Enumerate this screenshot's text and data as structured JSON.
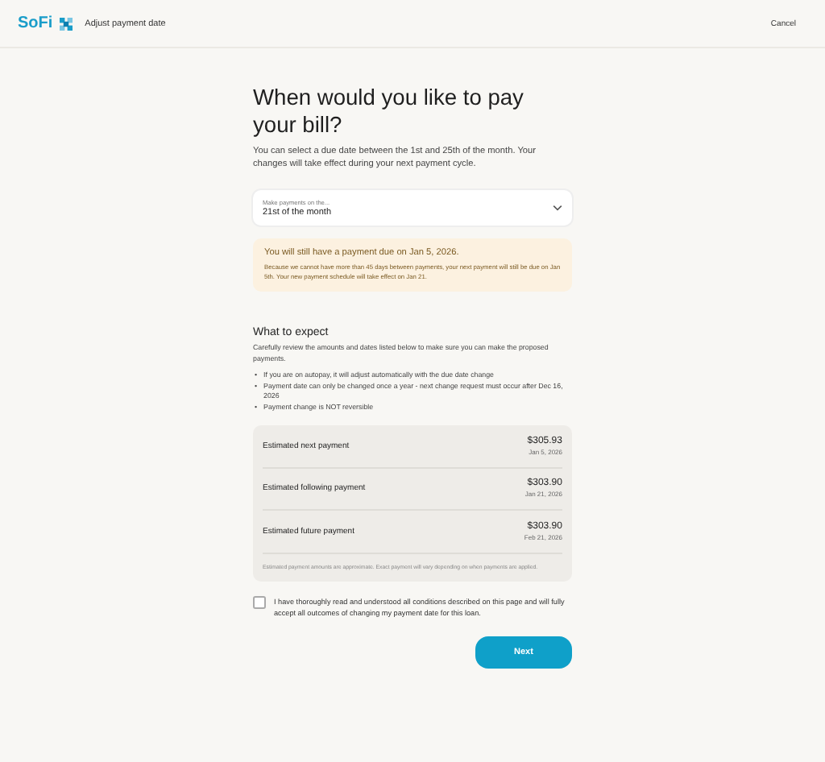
{
  "header": {
    "logo": "SoFi",
    "title": "Adjust payment date",
    "cancel": "Cancel"
  },
  "heading": "When would you like to pay your bill?",
  "intro": "You can select a due date between the 1st and 25th of the month. Your changes will take effect during your next payment cycle.",
  "dropdown": {
    "label": "Make payments on the...",
    "value": "21st of the month"
  },
  "notice": {
    "title": "You will still have a payment due on Jan 5, 2026.",
    "body": "Because we cannot have more than 45 days between payments, your next payment will still be due on Jan 5th. Your new payment schedule will take effect on Jan 21."
  },
  "expect": {
    "title": "What to expect",
    "description": "Carefully review the amounts and dates listed below to make sure you can make the proposed payments.",
    "bullets": [
      {
        "marker": "•",
        "text": "If you are on autopay, it will adjust automatically with the due date change"
      },
      {
        "marker": "•",
        "text": "Payment date can only be changed once a year - next change request must occur after Dec 16, 2026"
      },
      {
        "marker": "•",
        "text": "Payment change is NOT reversible"
      }
    ]
  },
  "payments": [
    {
      "label": "Estimated next payment",
      "amount": "$305.93",
      "date": "Jan 5, 2026"
    },
    {
      "label": "Estimated following payment",
      "amount": "$303.90",
      "date": "Jan 21, 2026"
    },
    {
      "label": "Estimated future payment",
      "amount": "$303.90",
      "date": "Feb 21, 2026"
    }
  ],
  "payments_note": "Estimated payment amounts are approximate. Exact payment will vary depending on when payments are applied.",
  "agreement": {
    "text": "I have thoroughly read and understood all conditions described on this page and will fully accept all outcomes of changing my payment date for this loan.",
    "checked": false
  },
  "next_button": "Next"
}
